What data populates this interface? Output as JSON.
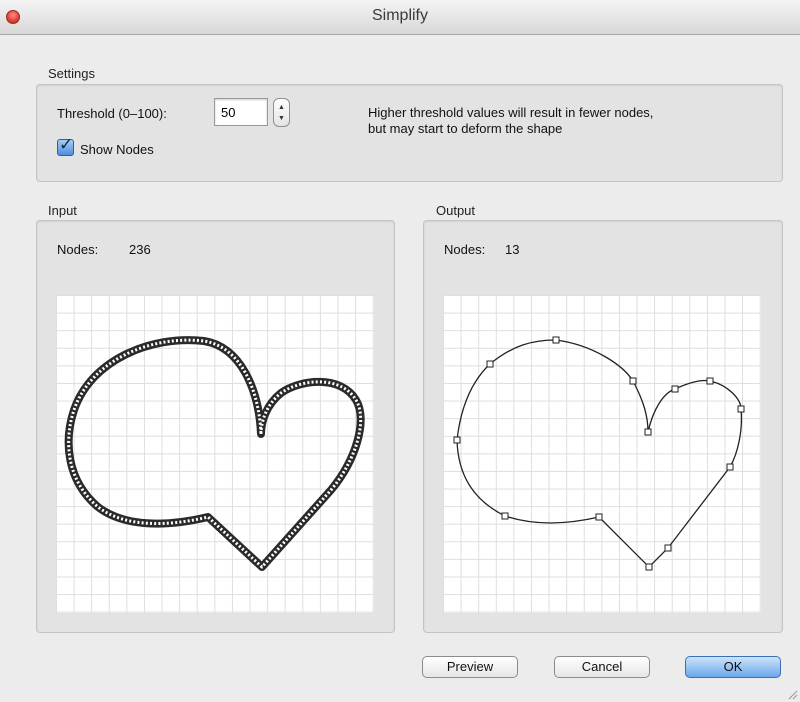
{
  "window": {
    "title": "Simplify"
  },
  "settings": {
    "group_label": "Settings",
    "threshold_label": "Threshold (0–100):",
    "threshold_value": "50",
    "help_text_line1": "Higher threshold values will result in fewer nodes,",
    "help_text_line2": "but may start to deform the shape",
    "show_nodes_label": "Show Nodes",
    "show_nodes_checked": true
  },
  "input": {
    "group_label": "Input",
    "nodes_label": "Nodes:",
    "nodes_count": "236"
  },
  "output": {
    "group_label": "Output",
    "nodes_label": "Nodes:",
    "nodes_count": "13"
  },
  "buttons": {
    "preview": "Preview",
    "cancel": "Cancel",
    "ok": "OK"
  },
  "colors": {
    "accent": "#6aa7ec",
    "close": "#e0463c"
  }
}
